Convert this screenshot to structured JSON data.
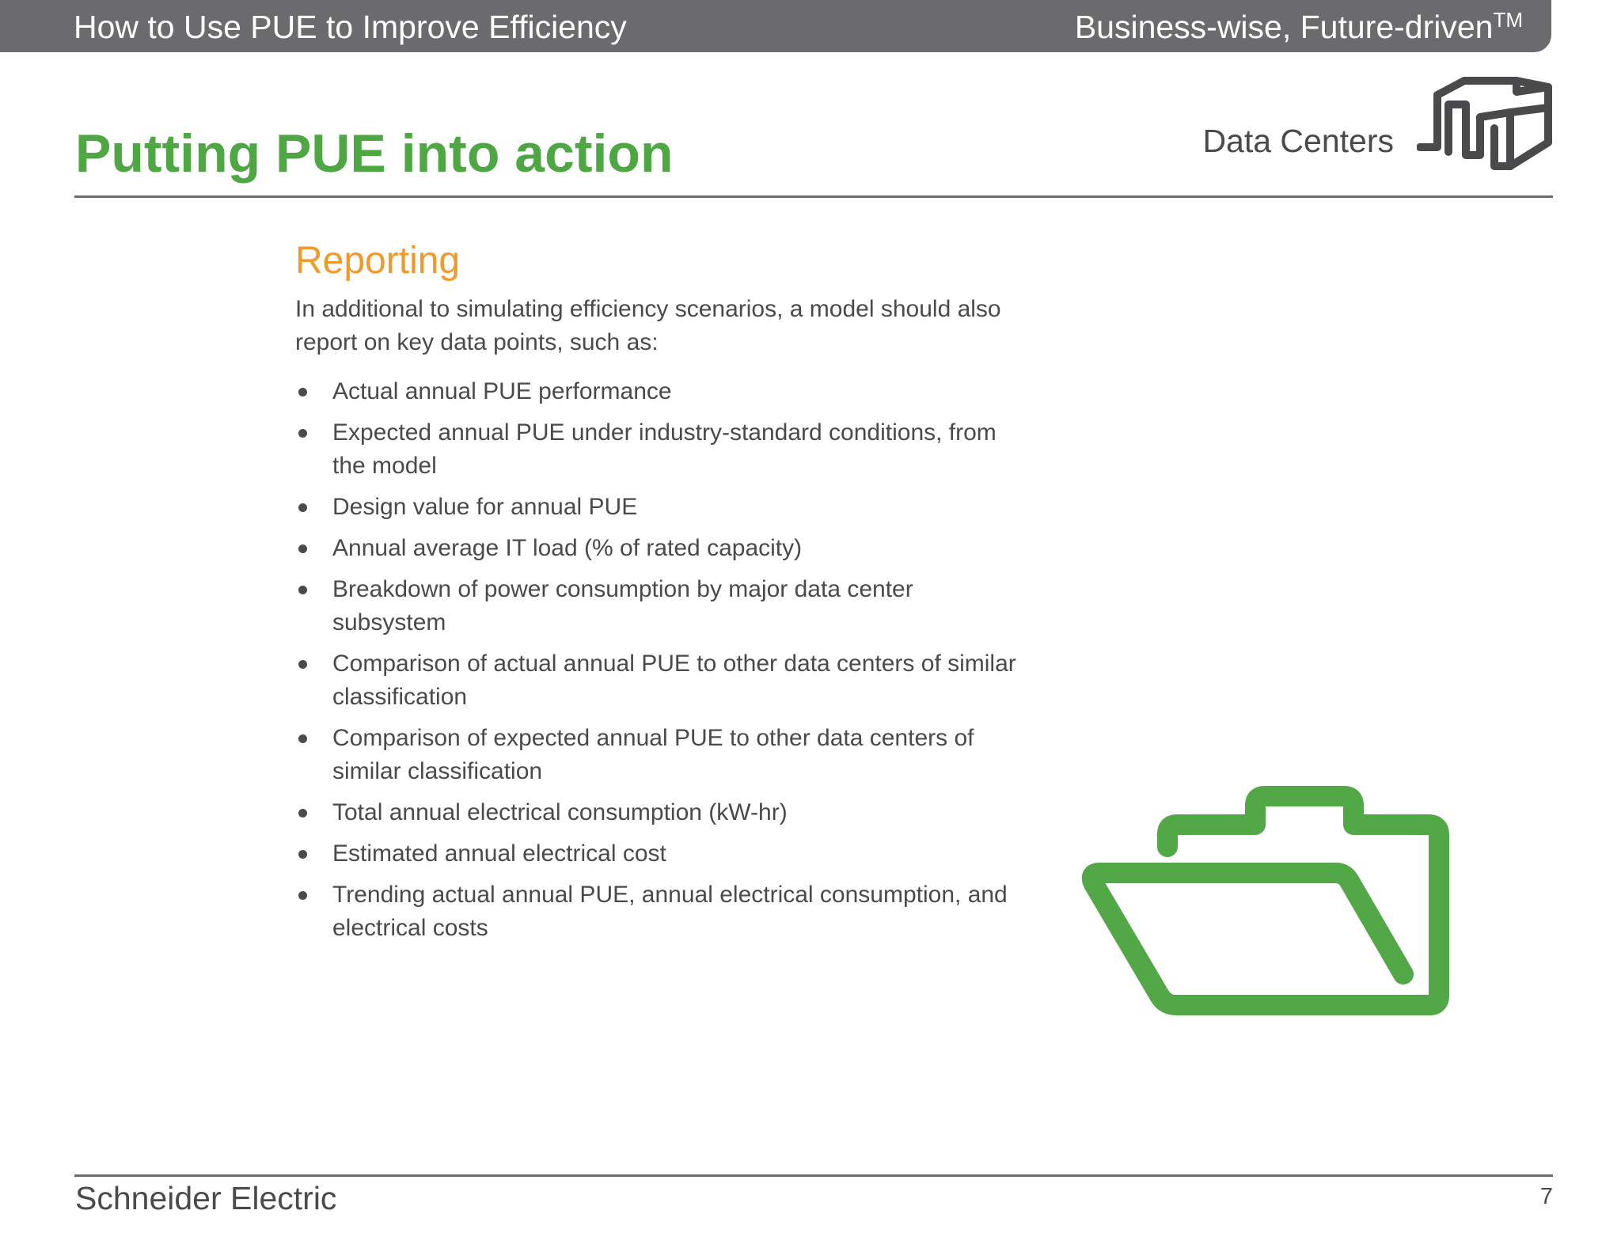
{
  "header": {
    "doc_title": "How to Use PUE to Improve Efficiency",
    "tagline": "Business-wise,  Future-driven",
    "tagline_mark": "TM"
  },
  "page": {
    "title": "Putting PUE into action",
    "section_label": "Data Centers",
    "section_icon": "data-center-building-icon"
  },
  "content": {
    "subhead": "Reporting",
    "intro": "In additional to simulating efficiency scenarios, a model should also report on key data points, such as:",
    "bullets": [
      "Actual annual PUE performance",
      "Expected annual PUE under industry-standard conditions, from the model",
      "Design value for annual PUE",
      "Annual average IT load (% of rated capacity)",
      "Breakdown of power consumption by major data center subsystem",
      "Comparison of actual annual PUE to other data centers of similar classification",
      "Comparison of expected annual PUE to other data centers of similar classification",
      "Total annual electrical consumption (kW-hr)",
      "Estimated annual electrical cost",
      "Trending actual annual PUE, annual electrical consumption, and electrical costs"
    ],
    "illustration_icon": "open-folder-icon"
  },
  "footer": {
    "brand": "Schneider Electric",
    "page_number": "7"
  },
  "colors": {
    "header_bar": "#6b6b6e",
    "title_green": "#4fa744",
    "subhead_orange": "#ef9a2b",
    "body_text": "#4a4a4c",
    "folder_green": "#52a847"
  }
}
